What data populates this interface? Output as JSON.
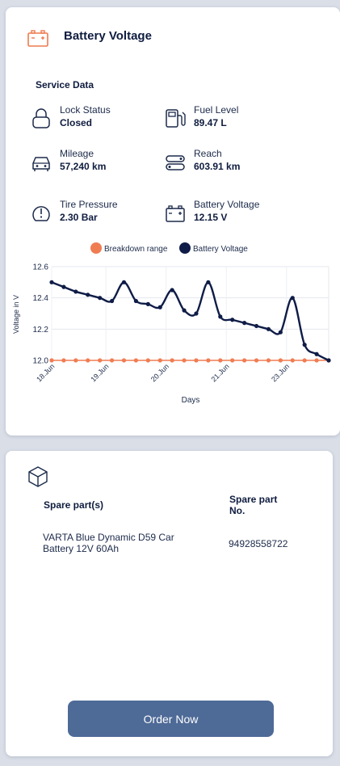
{
  "header": {
    "title": "Battery Voltage",
    "icon": "battery-icon",
    "accent_color": "#ee7a4f"
  },
  "service_data": {
    "title": "Service Data",
    "items": [
      {
        "label": "Lock Status",
        "value": "Closed",
        "icon": "lock-icon"
      },
      {
        "label": "Fuel Level",
        "value": "89.47 L",
        "icon": "fuel-pump-icon"
      },
      {
        "label": "Mileage",
        "value": "57,240 km",
        "icon": "car-icon"
      },
      {
        "label": "Reach",
        "value": "603.91 km",
        "icon": "road-icon"
      },
      {
        "label": "Tire Pressure",
        "value": "2.30 Bar",
        "icon": "tire-pressure-icon"
      },
      {
        "label": "Battery Voltage",
        "value": "12.15 V",
        "icon": "battery-icon"
      }
    ]
  },
  "chart_data": {
    "type": "line",
    "xlabel": "Days",
    "ylabel": "Voltage in V",
    "ylim": [
      12.0,
      12.6
    ],
    "yticks": [
      "12.6",
      "12.4",
      "12.2",
      "12.0"
    ],
    "xticks": [
      {
        "label": "18.Jun",
        "x": 0
      },
      {
        "label": "19.Jun",
        "x": 4.5
      },
      {
        "label": "20.Jun",
        "x": 9.5
      },
      {
        "label": "21.Jun",
        "x": 14.5
      },
      {
        "label": "23.Jun",
        "x": 19.5
      }
    ],
    "legend_position": "top",
    "grid": true,
    "series": [
      {
        "name": "Breakdown range",
        "color": "#f07c52",
        "points": [
          [
            0,
            12.0
          ],
          [
            1,
            12.0
          ],
          [
            2,
            12.0
          ],
          [
            3,
            12.0
          ],
          [
            4,
            12.0
          ],
          [
            5,
            12.0
          ],
          [
            6,
            12.0
          ],
          [
            7,
            12.0
          ],
          [
            8,
            12.0
          ],
          [
            9,
            12.0
          ],
          [
            10,
            12.0
          ],
          [
            11,
            12.0
          ],
          [
            12,
            12.0
          ],
          [
            13,
            12.0
          ],
          [
            14,
            12.0
          ],
          [
            15,
            12.0
          ],
          [
            16,
            12.0
          ],
          [
            17,
            12.0
          ],
          [
            18,
            12.0
          ],
          [
            19,
            12.0
          ],
          [
            20,
            12.0
          ],
          [
            21,
            12.0
          ],
          [
            22,
            12.0
          ],
          [
            23,
            12.0
          ]
        ]
      },
      {
        "name": "Battery Voltage",
        "color": "#0f1c47",
        "points": [
          [
            0,
            12.5
          ],
          [
            1,
            12.47
          ],
          [
            2,
            12.44
          ],
          [
            3,
            12.42
          ],
          [
            4,
            12.4
          ],
          [
            5,
            12.38
          ],
          [
            6,
            12.5
          ],
          [
            7,
            12.38
          ],
          [
            8,
            12.36
          ],
          [
            9,
            12.34
          ],
          [
            10,
            12.45
          ],
          [
            11,
            12.32
          ],
          [
            12,
            12.3
          ],
          [
            13,
            12.5
          ],
          [
            14,
            12.28
          ],
          [
            15,
            12.26
          ],
          [
            16,
            12.24
          ],
          [
            17,
            12.22
          ],
          [
            18,
            12.2
          ],
          [
            19,
            12.18
          ],
          [
            20,
            12.4
          ],
          [
            21,
            12.1
          ],
          [
            22,
            12.04
          ],
          [
            23,
            12.0
          ]
        ]
      }
    ]
  },
  "spare_parts": {
    "icon": "box-icon",
    "col1_header": "Spare part(s)",
    "col2_header_line1": "Spare part",
    "col2_header_line2": "No.",
    "rows": [
      {
        "part_line1": "VARTA Blue Dynamic D59 Car",
        "part_line2": "Battery 12V 60Ah",
        "number": "94928558722"
      }
    ],
    "order_button": "Order Now"
  }
}
